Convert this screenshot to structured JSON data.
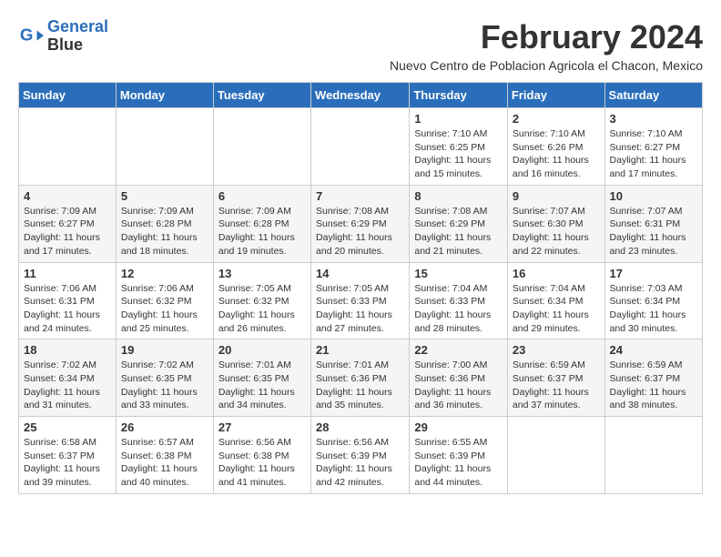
{
  "header": {
    "logo_line1": "General",
    "logo_line2": "Blue",
    "month_year": "February 2024",
    "location": "Nuevo Centro de Poblacion Agricola el Chacon, Mexico"
  },
  "weekdays": [
    "Sunday",
    "Monday",
    "Tuesday",
    "Wednesday",
    "Thursday",
    "Friday",
    "Saturday"
  ],
  "weeks": [
    [
      {
        "day": "",
        "info": ""
      },
      {
        "day": "",
        "info": ""
      },
      {
        "day": "",
        "info": ""
      },
      {
        "day": "",
        "info": ""
      },
      {
        "day": "1",
        "info": "Sunrise: 7:10 AM\nSunset: 6:25 PM\nDaylight: 11 hours\nand 15 minutes."
      },
      {
        "day": "2",
        "info": "Sunrise: 7:10 AM\nSunset: 6:26 PM\nDaylight: 11 hours\nand 16 minutes."
      },
      {
        "day": "3",
        "info": "Sunrise: 7:10 AM\nSunset: 6:27 PM\nDaylight: 11 hours\nand 17 minutes."
      }
    ],
    [
      {
        "day": "4",
        "info": "Sunrise: 7:09 AM\nSunset: 6:27 PM\nDaylight: 11 hours\nand 17 minutes."
      },
      {
        "day": "5",
        "info": "Sunrise: 7:09 AM\nSunset: 6:28 PM\nDaylight: 11 hours\nand 18 minutes."
      },
      {
        "day": "6",
        "info": "Sunrise: 7:09 AM\nSunset: 6:28 PM\nDaylight: 11 hours\nand 19 minutes."
      },
      {
        "day": "7",
        "info": "Sunrise: 7:08 AM\nSunset: 6:29 PM\nDaylight: 11 hours\nand 20 minutes."
      },
      {
        "day": "8",
        "info": "Sunrise: 7:08 AM\nSunset: 6:29 PM\nDaylight: 11 hours\nand 21 minutes."
      },
      {
        "day": "9",
        "info": "Sunrise: 7:07 AM\nSunset: 6:30 PM\nDaylight: 11 hours\nand 22 minutes."
      },
      {
        "day": "10",
        "info": "Sunrise: 7:07 AM\nSunset: 6:31 PM\nDaylight: 11 hours\nand 23 minutes."
      }
    ],
    [
      {
        "day": "11",
        "info": "Sunrise: 7:06 AM\nSunset: 6:31 PM\nDaylight: 11 hours\nand 24 minutes."
      },
      {
        "day": "12",
        "info": "Sunrise: 7:06 AM\nSunset: 6:32 PM\nDaylight: 11 hours\nand 25 minutes."
      },
      {
        "day": "13",
        "info": "Sunrise: 7:05 AM\nSunset: 6:32 PM\nDaylight: 11 hours\nand 26 minutes."
      },
      {
        "day": "14",
        "info": "Sunrise: 7:05 AM\nSunset: 6:33 PM\nDaylight: 11 hours\nand 27 minutes."
      },
      {
        "day": "15",
        "info": "Sunrise: 7:04 AM\nSunset: 6:33 PM\nDaylight: 11 hours\nand 28 minutes."
      },
      {
        "day": "16",
        "info": "Sunrise: 7:04 AM\nSunset: 6:34 PM\nDaylight: 11 hours\nand 29 minutes."
      },
      {
        "day": "17",
        "info": "Sunrise: 7:03 AM\nSunset: 6:34 PM\nDaylight: 11 hours\nand 30 minutes."
      }
    ],
    [
      {
        "day": "18",
        "info": "Sunrise: 7:02 AM\nSunset: 6:34 PM\nDaylight: 11 hours\nand 31 minutes."
      },
      {
        "day": "19",
        "info": "Sunrise: 7:02 AM\nSunset: 6:35 PM\nDaylight: 11 hours\nand 33 minutes."
      },
      {
        "day": "20",
        "info": "Sunrise: 7:01 AM\nSunset: 6:35 PM\nDaylight: 11 hours\nand 34 minutes."
      },
      {
        "day": "21",
        "info": "Sunrise: 7:01 AM\nSunset: 6:36 PM\nDaylight: 11 hours\nand 35 minutes."
      },
      {
        "day": "22",
        "info": "Sunrise: 7:00 AM\nSunset: 6:36 PM\nDaylight: 11 hours\nand 36 minutes."
      },
      {
        "day": "23",
        "info": "Sunrise: 6:59 AM\nSunset: 6:37 PM\nDaylight: 11 hours\nand 37 minutes."
      },
      {
        "day": "24",
        "info": "Sunrise: 6:59 AM\nSunset: 6:37 PM\nDaylight: 11 hours\nand 38 minutes."
      }
    ],
    [
      {
        "day": "25",
        "info": "Sunrise: 6:58 AM\nSunset: 6:37 PM\nDaylight: 11 hours\nand 39 minutes."
      },
      {
        "day": "26",
        "info": "Sunrise: 6:57 AM\nSunset: 6:38 PM\nDaylight: 11 hours\nand 40 minutes."
      },
      {
        "day": "27",
        "info": "Sunrise: 6:56 AM\nSunset: 6:38 PM\nDaylight: 11 hours\nand 41 minutes."
      },
      {
        "day": "28",
        "info": "Sunrise: 6:56 AM\nSunset: 6:39 PM\nDaylight: 11 hours\nand 42 minutes."
      },
      {
        "day": "29",
        "info": "Sunrise: 6:55 AM\nSunset: 6:39 PM\nDaylight: 11 hours\nand 44 minutes."
      },
      {
        "day": "",
        "info": ""
      },
      {
        "day": "",
        "info": ""
      }
    ]
  ]
}
